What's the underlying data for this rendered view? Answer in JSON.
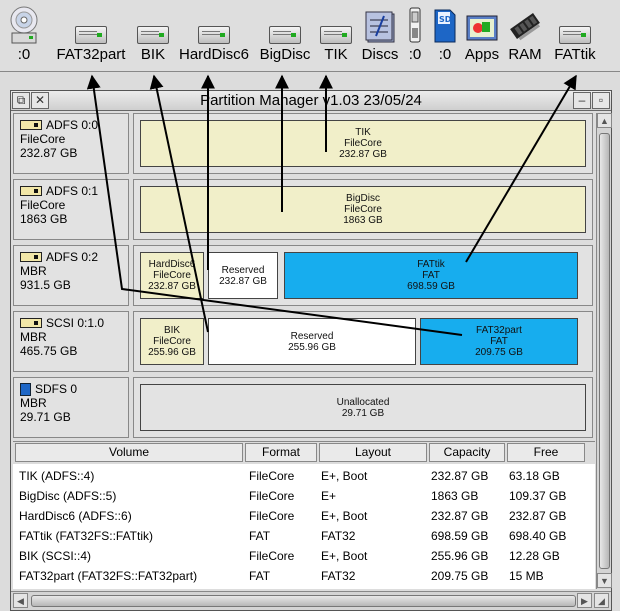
{
  "iconbar": {
    "items": [
      {
        "label": ":0",
        "icon": "cd-drive-icon"
      },
      {
        "label": "FAT32part",
        "icon": "hard-drive-icon"
      },
      {
        "label": "BIK",
        "icon": "hard-drive-icon"
      },
      {
        "label": "HardDisc6",
        "icon": "hard-drive-icon"
      },
      {
        "label": "BigDisc",
        "icon": "hard-drive-icon"
      },
      {
        "label": "TIK",
        "icon": "hard-drive-icon"
      },
      {
        "label": "Discs",
        "icon": "discs-icon"
      },
      {
        "label": ":0",
        "icon": "usb-stick-icon"
      },
      {
        "label": ":0",
        "icon": "sd-card-icon"
      },
      {
        "label": "Apps",
        "icon": "apps-icon"
      },
      {
        "label": "RAM",
        "icon": "ram-chip-icon"
      },
      {
        "label": "FATtik",
        "icon": "hard-drive-icon"
      }
    ]
  },
  "window": {
    "title": "Partition Manager v1.03 23/05/24"
  },
  "drives": [
    {
      "name": "ADFS 0:0",
      "scheme": "FileCore",
      "size": "232.87 GB",
      "partitions": [
        {
          "name": "TIK",
          "format": "FileCore",
          "size": "232.87 GB",
          "kind": "filecore"
        }
      ]
    },
    {
      "name": "ADFS 0:1",
      "scheme": "FileCore",
      "size": "1863 GB",
      "partitions": [
        {
          "name": "BigDisc",
          "format": "FileCore",
          "size": "1863 GB",
          "kind": "filecore"
        }
      ]
    },
    {
      "name": "ADFS 0:2",
      "scheme": "MBR",
      "size": "931.5 GB",
      "partitions": [
        {
          "name": "HardDisc6",
          "format": "FileCore",
          "size": "232.87 GB",
          "kind": "filecore"
        },
        {
          "name": "Reserved",
          "format": "",
          "size": "232.87 GB",
          "kind": "reserved"
        },
        {
          "name": "FATtik",
          "format": "FAT",
          "size": "698.59 GB",
          "kind": "fat"
        }
      ]
    },
    {
      "name": "SCSI 0:1.0",
      "scheme": "MBR",
      "size": "465.75 GB",
      "partitions": [
        {
          "name": "BIK",
          "format": "FileCore",
          "size": "255.96 GB",
          "kind": "filecore"
        },
        {
          "name": "Reserved",
          "format": "",
          "size": "255.96 GB",
          "kind": "reserved"
        },
        {
          "name": "FAT32part",
          "format": "FAT",
          "size": "209.75 GB",
          "kind": "fat"
        }
      ]
    },
    {
      "name": "SDFS 0",
      "scheme": "MBR",
      "size": "29.71 GB",
      "partitions": [
        {
          "name": "Unallocated",
          "format": "",
          "size": "29.71 GB",
          "kind": "unallocated"
        }
      ]
    }
  ],
  "table": {
    "columns": [
      "Volume",
      "Format",
      "Layout",
      "Capacity",
      "Free"
    ],
    "rows": [
      [
        "TIK (ADFS::4)",
        "FileCore",
        "E+, Boot",
        "232.87 GB",
        "63.18 GB"
      ],
      [
        "BigDisc (ADFS::5)",
        "FileCore",
        "E+",
        "1863 GB",
        "109.37 GB"
      ],
      [
        "HardDisc6 (ADFS::6)",
        "FileCore",
        "E+, Boot",
        "232.87 GB",
        "232.87 GB"
      ],
      [
        "FATtik (FAT32FS::FATtik)",
        "FAT",
        "FAT32",
        "698.59 GB",
        "698.40 GB"
      ],
      [
        "BIK (SCSI::4)",
        "FileCore",
        "E+, Boot",
        "255.96 GB",
        "12.28 GB"
      ],
      [
        "FAT32part (FAT32FS::FAT32part)",
        "FAT",
        "FAT32",
        "209.75 GB",
        "15 MB"
      ]
    ]
  },
  "colors": {
    "filecore": "#f1efc9",
    "fat": "#17adee",
    "reserved": "#ffffff",
    "unallocated": "#e3e3e3"
  }
}
